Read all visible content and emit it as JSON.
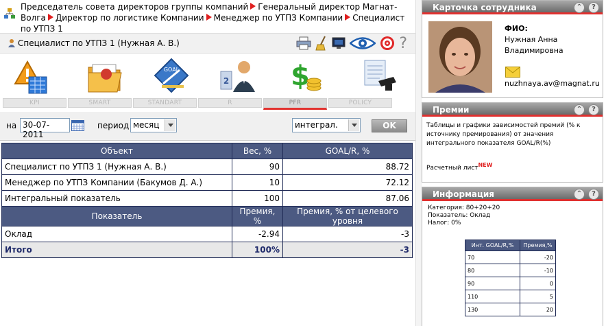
{
  "breadcrumb": {
    "items": [
      "Председатель совета директоров группы компаний",
      "Генеральный директор Магнат-Волга",
      "Директор по логистике Компании",
      "Менеджер по УТПЗ Компании",
      "Специалист по УТПЗ 1"
    ]
  },
  "userbar": {
    "name": "Специалист по УТПЗ 1  (Нужная А. В.)"
  },
  "tabs": [
    "KPI",
    "SMART",
    "STANDART",
    "R",
    "PFR",
    "Policy"
  ],
  "filters": {
    "date_label": "на",
    "date_value": "30-07-2011",
    "period_label": "период",
    "period_value": "месяц",
    "mode_value": "интеграл.",
    "ok_label": "OK"
  },
  "main_table": {
    "headers": [
      "Объект",
      "Вес, %",
      "GOAL/R, %"
    ],
    "rows": [
      [
        "Специалист по УТПЗ 1 (Нужная А. В.)",
        "90",
        "88.72"
      ],
      [
        "Менеджер по УТПЗ Компании (Бакумов Д. А.)",
        "10",
        "72.12"
      ],
      [
        "Интегральный показатель",
        "100",
        "87.06"
      ]
    ],
    "headers2": [
      "Показатель",
      "Премия, %",
      "Премия, % от целевого уровня"
    ],
    "rows2": [
      [
        "Оклад",
        "-2.94",
        "-3"
      ]
    ],
    "total": [
      "Итого",
      "100%",
      "-3"
    ]
  },
  "card": {
    "title": "Карточка сотрудника",
    "fio_label": "ФИО:",
    "fio_value": "Нужная Анна Владимировна",
    "email": "nuzhnaya.av@magnat.ru"
  },
  "bonus": {
    "title": "Премии",
    "text": "Таблицы и графики зависимостей премий (% к источнику премирования) от значения интегрального показателя GOAL/R(%)",
    "link": "Расчетный лист",
    "badge": "NEW"
  },
  "info": {
    "title": "Информация",
    "category": "Категория: 80+20+20",
    "indicator": "Показатель: Оклад",
    "tax": "Налог: 0%",
    "headers": [
      "Инт. GOAL/R,%",
      "Премия,%"
    ],
    "rows": [
      [
        "70",
        "-20"
      ],
      [
        "80",
        "-10"
      ],
      [
        "90",
        "0"
      ],
      [
        "110",
        "5"
      ],
      [
        "130",
        "20"
      ]
    ]
  },
  "colors": {
    "accent": "#e0302f",
    "table_header": "#4c5a82",
    "border": "#1f2a55"
  }
}
